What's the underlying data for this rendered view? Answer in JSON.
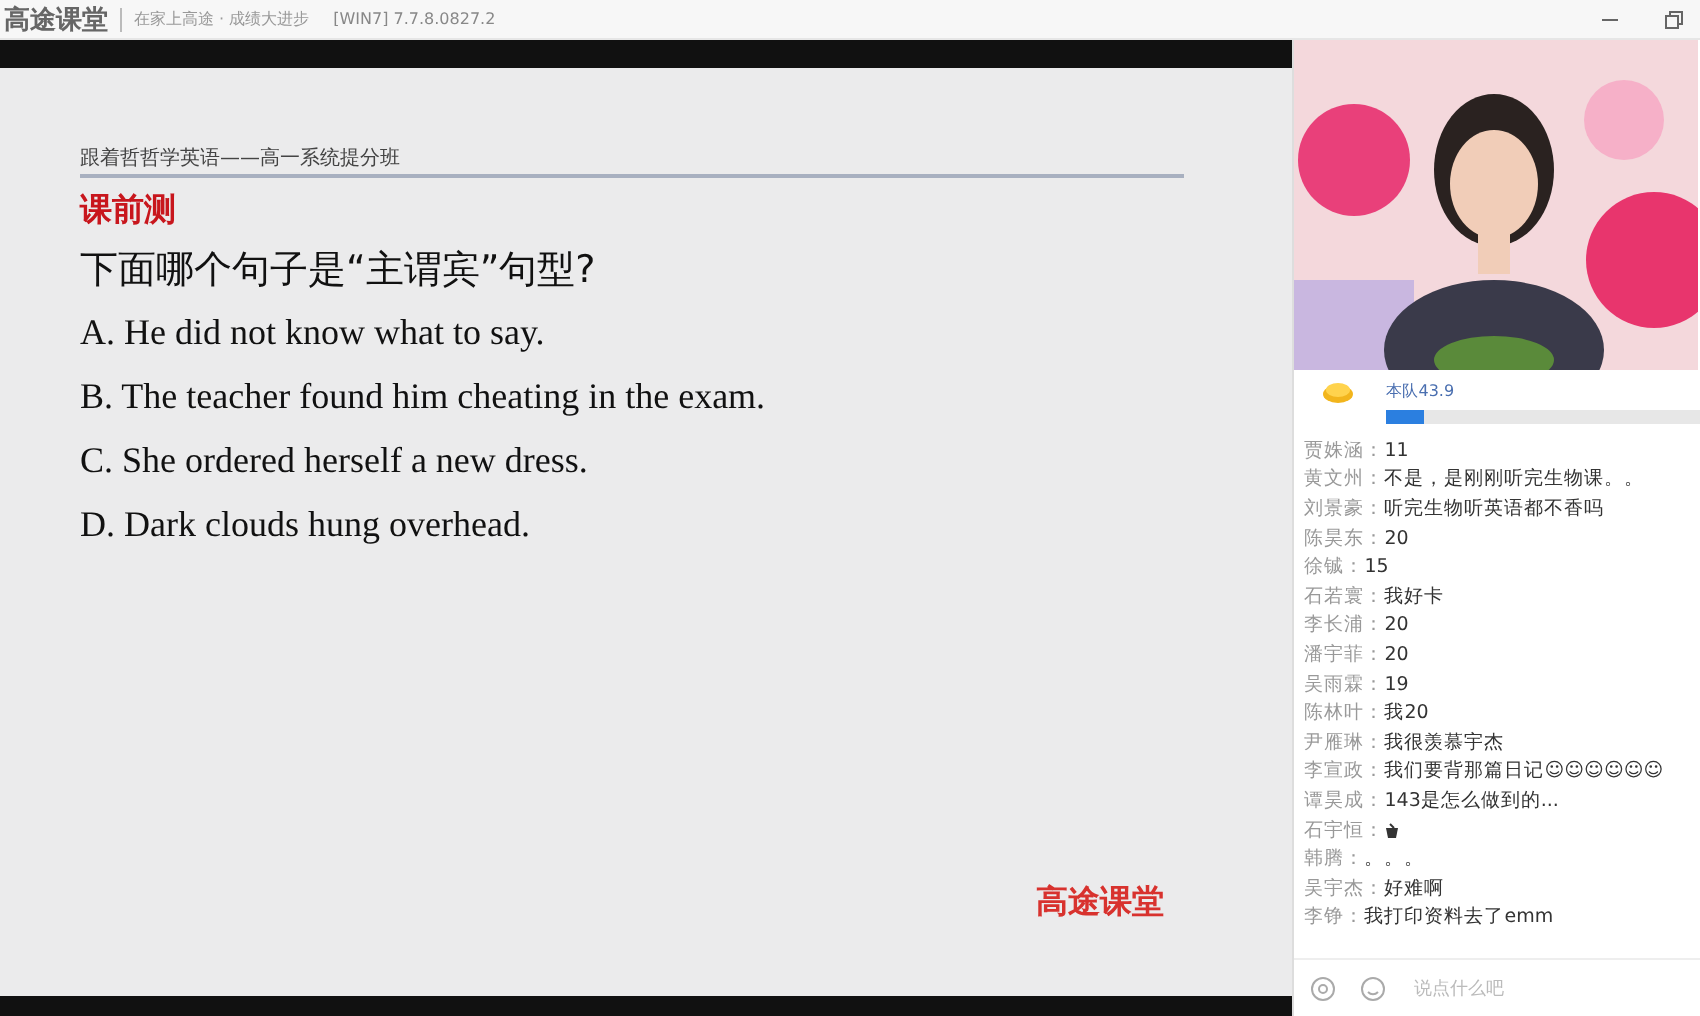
{
  "window": {
    "logo": "高途课堂",
    "slogan": "在家上高途 · 成绩大进步",
    "version": "[WIN7] 7.7.8.0827.2"
  },
  "slide": {
    "course": "跟着哲哲学英语——高一系统提分班",
    "section": "课前测",
    "question": "下面哪个句子是“主谓宾”句型?",
    "options": [
      "A. He did not know what to say.",
      "B. The teacher found him cheating in the exam.",
      "C. She ordered herself a new dress.",
      "D. Dark clouds hung overhead."
    ],
    "brand": "高途课堂"
  },
  "team": {
    "score": "本队43.9",
    "level": 0.12
  },
  "chat": [
    {
      "kind": "text",
      "name": "贾姝涵：",
      "text": "11"
    },
    {
      "kind": "text",
      "name": "黄文州：",
      "text": "不是，是刚刚听完生物课。。"
    },
    {
      "kind": "text",
      "name": "刘景豪：",
      "text": "听完生物听英语都不香吗"
    },
    {
      "kind": "text",
      "name": "陈昊东：",
      "text": "20"
    },
    {
      "kind": "text",
      "name": "徐铖：",
      "text": "15"
    },
    {
      "kind": "text",
      "name": "石若寰：",
      "text": "我好卡"
    },
    {
      "kind": "text",
      "name": "李长浦：",
      "text": "20"
    },
    {
      "kind": "text",
      "name": "潘宇菲：",
      "text": "20"
    },
    {
      "kind": "text",
      "name": "吴雨霖：",
      "text": "19"
    },
    {
      "kind": "text",
      "name": "陈林叶：",
      "text": "我20"
    },
    {
      "kind": "text",
      "name": "尹雁琳：",
      "text": "我很羡慕宇杰"
    },
    {
      "kind": "text",
      "name": "李宣政：",
      "text": "我们要背那篇日记☺☺☺☺☺☺"
    },
    {
      "kind": "text",
      "name": "谭昊成：",
      "text": "143是怎么做到的..."
    },
    {
      "kind": "icon",
      "name": "石宇恒："
    },
    {
      "kind": "text",
      "name": "韩腾：",
      "text": "。。。"
    },
    {
      "kind": "text",
      "name": "吴宇杰：",
      "text": "好难啊"
    },
    {
      "kind": "text",
      "name": "李铮：",
      "text": "我打印资料去了emm"
    }
  ],
  "input": {
    "placeholder": "说点什么吧"
  }
}
